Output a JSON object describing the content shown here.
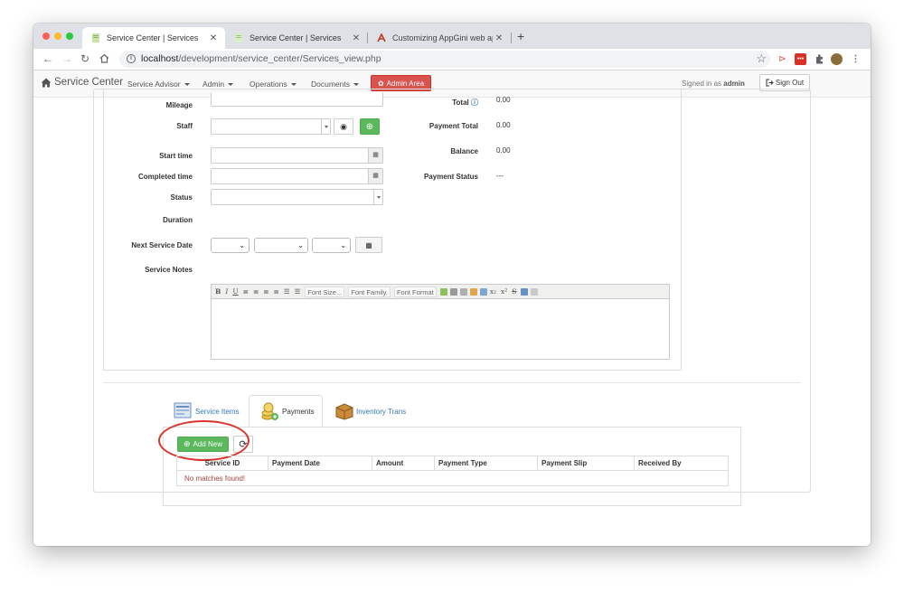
{
  "browser": {
    "tabs": [
      {
        "title": "Service Center | Services",
        "active": true
      },
      {
        "title": "Service Center | Services",
        "active": false
      },
      {
        "title": "Customizing AppGini web appl",
        "active": false
      }
    ],
    "url_host": "localhost",
    "url_path": "/development/service_center/Services_view.php",
    "colors": {
      "close": "#fe5f57",
      "minimize": "#febc2e",
      "maximize": "#28c840"
    }
  },
  "navbar": {
    "brand": "Service Center",
    "menus": [
      "Service Advisor",
      "Admin",
      "Operations",
      "Documents"
    ],
    "admin_area": "Admin Area",
    "signed_in_prefix": "Signed in as",
    "signed_in_user": "admin",
    "sign_out": "Sign Out"
  },
  "form": {
    "labels": {
      "mileage": "Mileage",
      "staff": "Staff",
      "start_time": "Start time",
      "completed_time": "Completed time",
      "status": "Status",
      "duration": "Duration",
      "next_service_date": "Next Service Date",
      "service_notes": "Service Notes"
    },
    "summary": [
      {
        "label": "Total",
        "value": "0.00"
      },
      {
        "label": "Payment Total",
        "value": "0.00"
      },
      {
        "label": "Balance",
        "value": "0.00"
      },
      {
        "label": "Payment Status",
        "value": "---"
      }
    ],
    "editor_toolbar": {
      "font_size": "Font Size...",
      "font_family": "Font Family.",
      "font_format": "Font Format"
    }
  },
  "children": {
    "tabs": [
      "Service Items",
      "Payments",
      "Inventory Trans"
    ],
    "active_tab": "Payments",
    "add_new": "Add New",
    "columns": [
      "Service ID",
      "Payment Date",
      "Amount",
      "Payment Type",
      "Payment Slip",
      "Received By"
    ],
    "empty_message": "No matches found!"
  },
  "colors": {
    "accent_green": "#5cb85c",
    "danger": "#d9534f",
    "highlight_ring": "#d9342b",
    "link": "#337ab7"
  }
}
